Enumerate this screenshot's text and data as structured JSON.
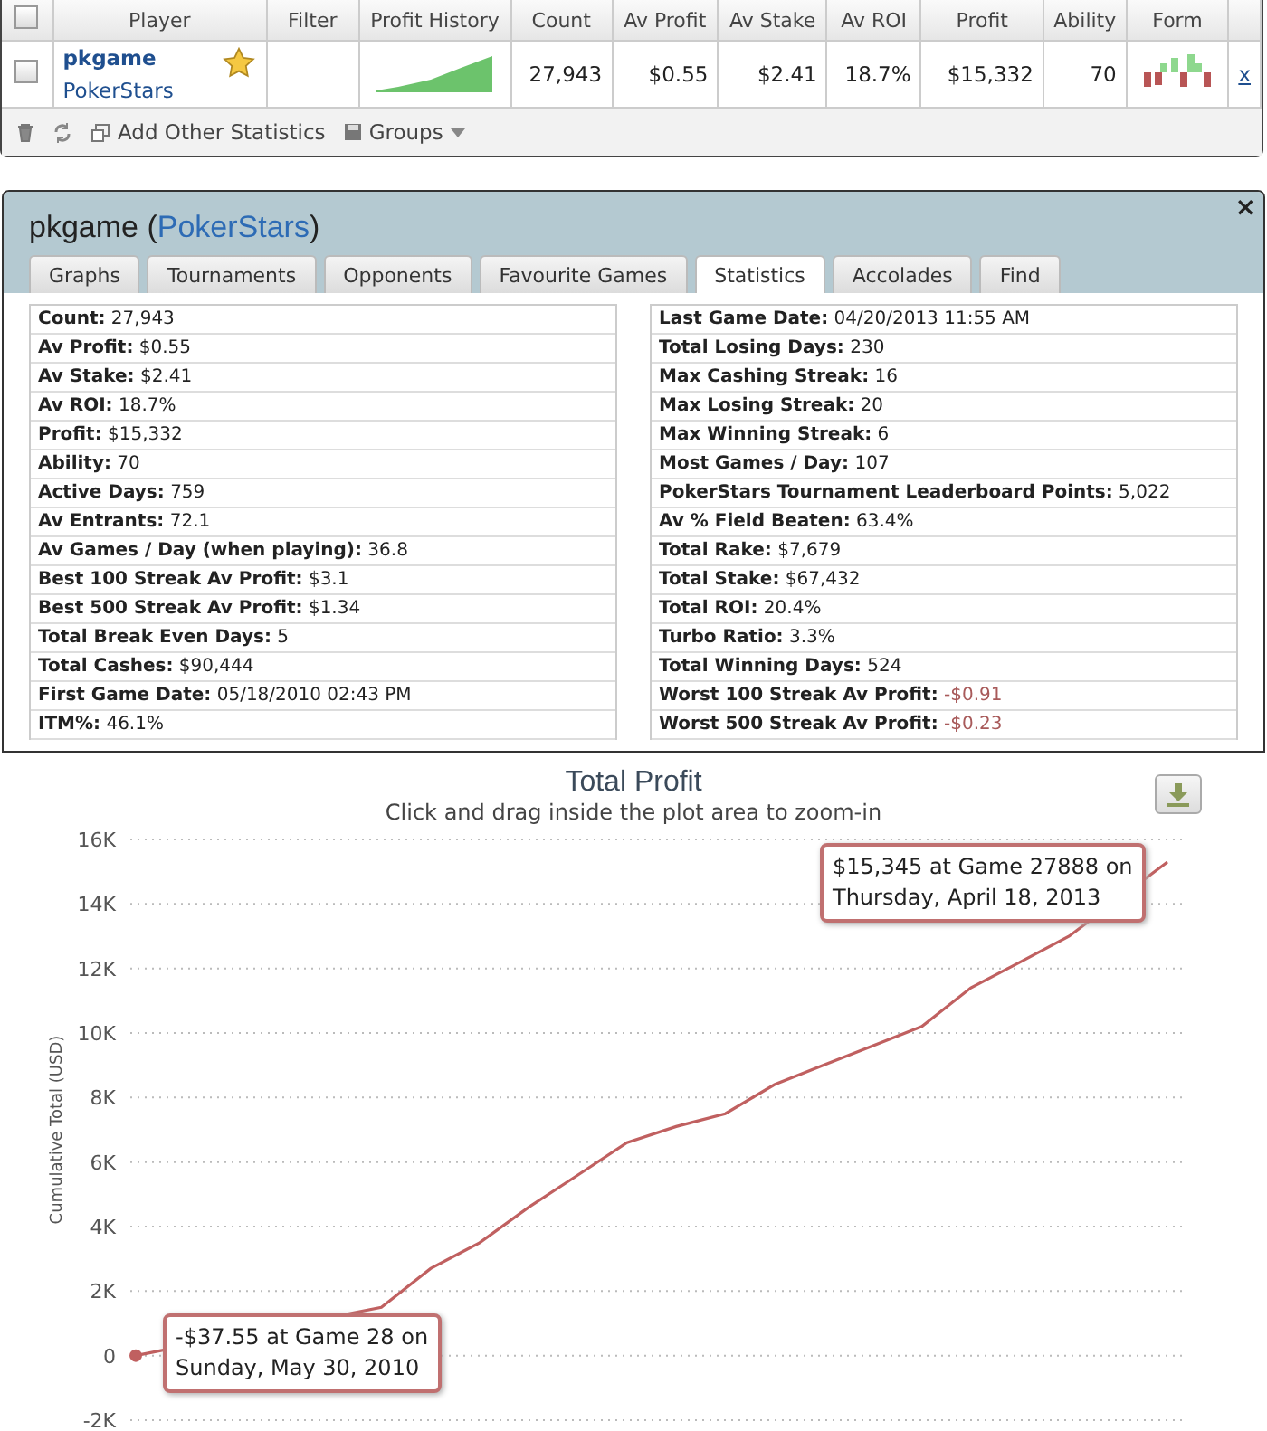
{
  "table": {
    "columns": [
      "Player",
      "Filter",
      "Profit History",
      "Count",
      "Av Profit",
      "Av Stake",
      "Av ROI",
      "Profit",
      "Ability",
      "Form"
    ],
    "header_checked": false,
    "rows": [
      {
        "checked": false,
        "player": "pkgame",
        "site": "PokerStars",
        "favourite": true,
        "filter": "",
        "count": "27,943",
        "av_profit": "$0.55",
        "av_stake": "$2.41",
        "av_roi": "18.7%",
        "profit": "$15,332",
        "ability": "70",
        "remove": "x"
      }
    ],
    "toolbar": [
      "Add Other Statistics",
      "Groups"
    ]
  },
  "panel": {
    "name": "pkgame (",
    "site": "PokerStars",
    "name_end": ")",
    "close": "×",
    "tabs": [
      {
        "label": "Graphs",
        "selected": false
      },
      {
        "label": "Tournaments",
        "selected": false
      },
      {
        "label": "Opponents",
        "selected": false
      },
      {
        "label": "Favourite Games",
        "selected": false
      },
      {
        "label": "Statistics",
        "selected": true
      },
      {
        "label": "Accolades",
        "selected": false
      },
      {
        "label": "Find",
        "selected": false
      }
    ],
    "columns": [
      [
        {
          "label": "Count:",
          "value": "27,943",
          "negative": false
        },
        {
          "label": "Av Profit:",
          "value": "$0.55",
          "negative": false
        },
        {
          "label": "Av Stake:",
          "value": "$2.41",
          "negative": false
        },
        {
          "label": "Av ROI:",
          "value": "18.7%",
          "negative": false
        },
        {
          "label": "Profit:",
          "value": "$15,332",
          "negative": false
        },
        {
          "label": "Ability:",
          "value": "70",
          "negative": false
        },
        {
          "label": "Active Days:",
          "value": "759",
          "negative": false
        },
        {
          "label": "Av Entrants:",
          "value": "72.1",
          "negative": false
        },
        {
          "label": "Av Games / Day (when playing):",
          "value": "36.8",
          "negative": false
        },
        {
          "label": "Best 100 Streak Av Profit:",
          "value": "$3.1",
          "negative": false
        },
        {
          "label": "Best 500 Streak Av Profit:",
          "value": "$1.34",
          "negative": false
        },
        {
          "label": "Total Break Even Days:",
          "value": "5",
          "negative": false
        },
        {
          "label": "Total Cashes:",
          "value": "$90,444",
          "negative": false
        },
        {
          "label": "First Game Date:",
          "value": "05/18/2010 02:43 PM",
          "negative": false
        },
        {
          "label": "ITM%:",
          "value": "46.1%",
          "negative": false
        }
      ],
      [
        {
          "label": "Last Game Date:",
          "value": "04/20/2013 11:55 AM",
          "negative": false
        },
        {
          "label": "Total Losing Days:",
          "value": "230",
          "negative": false
        },
        {
          "label": "Max Cashing Streak:",
          "value": "16",
          "negative": false
        },
        {
          "label": "Max Losing Streak:",
          "value": "20",
          "negative": false
        },
        {
          "label": "Max Winning Streak:",
          "value": "6",
          "negative": false
        },
        {
          "label": "Most Games / Day:",
          "value": "107",
          "negative": false
        },
        {
          "label": "PokerStars Tournament Leaderboard Points:",
          "value": "5,022",
          "negative": false
        },
        {
          "label": "Av % Field Beaten:",
          "value": "63.4%",
          "negative": false
        },
        {
          "label": "Total Rake:",
          "value": "$7,679",
          "negative": false
        },
        {
          "label": "Total Stake:",
          "value": "$67,432",
          "negative": false
        },
        {
          "label": "Total ROI:",
          "value": "20.4%",
          "negative": false
        },
        {
          "label": "Turbo Ratio:",
          "value": "3.3%",
          "negative": false
        },
        {
          "label": "Total Winning Days:",
          "value": "524",
          "negative": false
        },
        {
          "label": "Worst 100 Streak Av Profit:",
          "value": "-$0.91",
          "negative": true
        },
        {
          "label": "Worst 500 Streak Av Profit:",
          "value": "-$0.23",
          "negative": true
        }
      ]
    ]
  },
  "chart": {
    "chart_data": {
      "type": "line",
      "title": "Total Profit",
      "subtitle": "Click and drag inside the plot area to zoom-in",
      "ylabel": "Cumulative Total (USD)",
      "ylim": [
        -2000,
        16000
      ],
      "yticks": [
        {
          "value": -2000,
          "label": "-2K"
        },
        {
          "value": 0,
          "label": "0"
        },
        {
          "value": 2000,
          "label": "2K"
        },
        {
          "value": 4000,
          "label": "4K"
        },
        {
          "value": 6000,
          "label": "6K"
        },
        {
          "value": 8000,
          "label": "8K"
        },
        {
          "value": 10000,
          "label": "10K"
        },
        {
          "value": 12000,
          "label": "12K"
        },
        {
          "value": 14000,
          "label": "14K"
        },
        {
          "value": 16000,
          "label": "16K"
        }
      ],
      "grid": true,
      "series": [
        {
          "color": "#c06060",
          "values": [
            0,
            null,
            null,
            null,
            null,
            1500,
            2700,
            3500,
            4600,
            5600,
            6600,
            7100,
            7500,
            8400,
            9000,
            9600,
            10200,
            11400,
            12200,
            13000,
            null,
            15300
          ]
        }
      ],
      "annotations": [
        {
          "text": "$15,345 at Game 27888 on\nThursday, April 18, 2013"
        },
        {
          "text": "-$37.55 at Game 28 on\nSunday, May 30, 2010"
        }
      ]
    }
  }
}
